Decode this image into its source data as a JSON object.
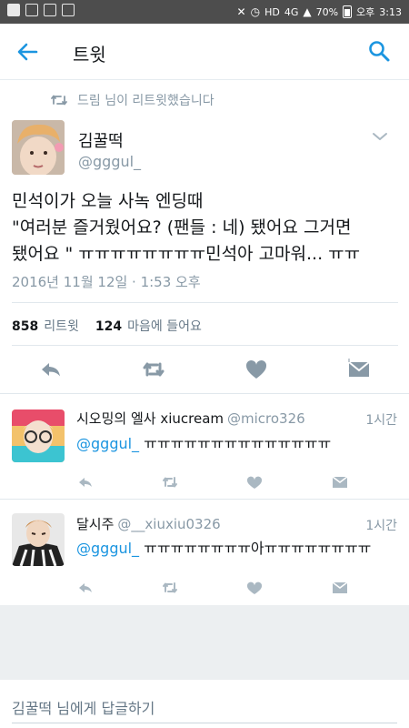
{
  "status_bar": {
    "battery": "70%",
    "ampm": "오후",
    "time": "3:13",
    "network": "4G",
    "hd": "HD"
  },
  "header": {
    "title": "트윗"
  },
  "retweet_notice": "드림 님이 리트윗했습니다",
  "tweet": {
    "name": "김꿀떡",
    "handle": "@gggul_",
    "lines": [
      "민석이가 오늘 사녹 엔딩때",
      "\"여러분 즐거웠어요? (팬들 : 네) 됐어요 그거면",
      "됐어요 \" ㅠㅠㅠㅠㅠㅠㅠㅠ민석아 고마워... ㅠㅠ"
    ],
    "timestamp": "2016년 11월 12일 · 1:53 오후",
    "retweet_count": "858",
    "retweet_label": "리트윗",
    "like_count": "124",
    "like_label": "마음에 들어요"
  },
  "replies": [
    {
      "name": "시오밍의 엘사 xiucream",
      "handle": "@micro326",
      "time": "1시간",
      "mention": "@gggul_",
      "text": " ㅠㅠㅠㅠㅠㅠㅠㅠㅠㅠㅠㅠㅠㅠ"
    },
    {
      "name": "달시주",
      "handle": "@__xiuxiu0326",
      "time": "1시간",
      "mention": "@gggul_",
      "text": " ㅠㅠㅠㅠㅠㅠㅠㅠ아ㅠㅠㅠㅠㅠㅠㅠㅠ"
    }
  ],
  "reply_placeholder": "김꿀떡 님에게 답글하기",
  "colors": {
    "accent": "#1b95e0",
    "icon_gray": "#8899a6",
    "text": "#14171a"
  }
}
